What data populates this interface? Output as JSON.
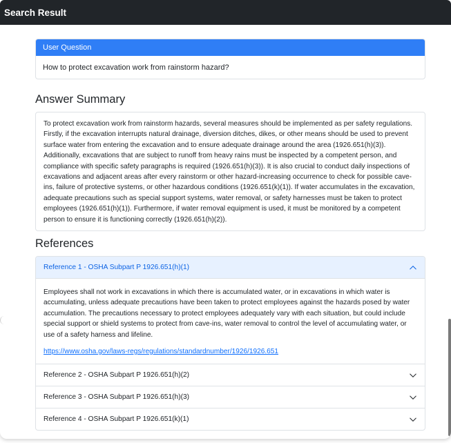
{
  "window": {
    "title": "Search Result"
  },
  "question": {
    "header": "User Question",
    "text": "How to protect excavation work from rainstorm hazard?"
  },
  "answer": {
    "heading": "Answer Summary",
    "text": "To protect excavation work from rainstorm hazards, several measures should be implemented as per safety regulations. Firstly, if the excavation interrupts natural drainage, diversion ditches, dikes, or other means should be used to prevent surface water from entering the excavation and to ensure adequate drainage around the area (1926.651(h)(3)). Additionally, excavations that are subject to runoff from heavy rains must be inspected by a competent person, and compliance with specific safety paragraphs is required (1926.651(h)(3)). It is also crucial to conduct daily inspections of excavations and adjacent areas after every rainstorm or other hazard-increasing occurrence to check for possible cave-ins, failure of protective systems, or other hazardous conditions (1926.651(k)(1)). If water accumulates in the excavation, adequate precautions such as special support systems, water removal, or safety harnesses must be taken to protect employees (1926.651(h)(1)). Furthermore, if water removal equipment is used, it must be monitored by a competent person to ensure it is functioning correctly (1926.651(h)(2))."
  },
  "references": {
    "heading": "References",
    "items": [
      {
        "label": "Reference 1 - OSHA Subpart P 1926.651(h)(1)",
        "expanded": true,
        "body": "Employees shall not work in excavations in which there is accumulated water, or in excavations in which water is accumulating, unless adequate precautions have been taken to protect employees against the hazards posed by water accumulation. The precautions necessary to protect employees adequately vary with each situation, but could include special support or shield systems to protect from cave-ins, water removal to control the level of accumulating water, or use of a safety harness and lifeline.",
        "link": "https://www.osha.gov/laws-regs/regulations/standardnumber/1926/1926.651"
      },
      {
        "label": "Reference 2 - OSHA Subpart P 1926.651(h)(2)",
        "expanded": false
      },
      {
        "label": "Reference 3 - OSHA Subpart P 1926.651(h)(3)",
        "expanded": false
      },
      {
        "label": "Reference 4 - OSHA Subpart P 1926.651(k)(1)",
        "expanded": false
      }
    ]
  },
  "colors": {
    "titlebar": "#212529",
    "question_header": "#2f7ef6",
    "accordion_open_bg": "#e7f1ff",
    "accordion_open_text": "#0c63e4",
    "link": "#0d6efd"
  },
  "icons": {
    "expanded": "chevron-up-icon",
    "collapsed": "chevron-down-icon"
  }
}
